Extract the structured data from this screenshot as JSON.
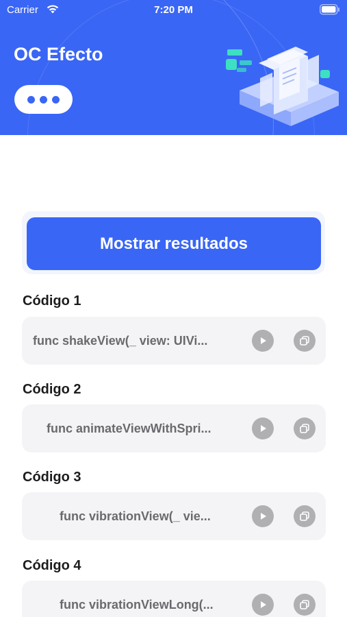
{
  "status_bar": {
    "carrier": "Carrier",
    "time": "7:20 PM"
  },
  "header": {
    "title": "OC Efecto",
    "background_color": "#3a66f5",
    "more_icon": "more-horizontal-icon"
  },
  "actions": {
    "show_results_label": "Mostrar resultados"
  },
  "codes": [
    {
      "heading": "Código 1",
      "code": "func shakeView(_ view: UIVi..."
    },
    {
      "heading": "Código 2",
      "code": "func animateViewWithSpri..."
    },
    {
      "heading": "Código 3",
      "code": "func vibrationView(_ vie..."
    },
    {
      "heading": "Código 4",
      "code": "func vibrationViewLong(..."
    }
  ],
  "icons": {
    "play": "play-icon",
    "copy": "copy-icon"
  },
  "colors": {
    "accent": "#3a66f5",
    "card_bg": "#f4f4f6",
    "icon_bg": "#b0b0b3"
  }
}
